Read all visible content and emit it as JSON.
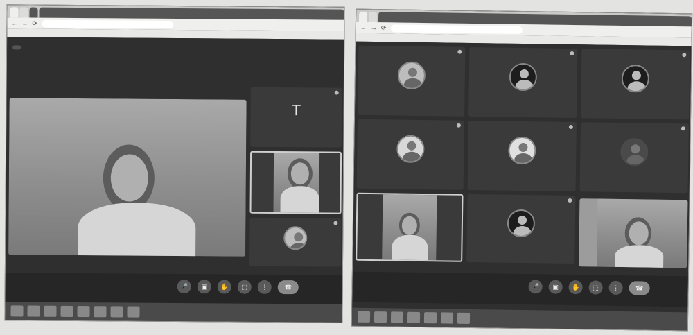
{
  "shot1": {
    "tabs": [
      "",
      "",
      "",
      ""
    ],
    "url": "",
    "bookmarks": [
      "",
      "",
      ""
    ],
    "pill": "",
    "main_tile_name": "",
    "tiles": [
      {
        "letter": "T",
        "name": ""
      },
      {
        "name": ""
      },
      {
        "name": ""
      }
    ],
    "meeting_code": "",
    "controls": [
      "mic-icon",
      "camera-icon",
      "raise-hand-icon",
      "present-icon",
      "more-icon",
      "end-call-icon"
    ],
    "taskbar_icons": [
      "",
      "",
      "",
      "",
      "",
      "",
      "",
      "",
      ""
    ]
  },
  "shot2": {
    "tabs": [
      "",
      "",
      ""
    ],
    "url": "",
    "bookmarks": [
      "",
      "",
      ""
    ],
    "tiles": [
      {
        "name": ""
      },
      {
        "name": ""
      },
      {
        "name": ""
      },
      {
        "name": ""
      },
      {
        "name": ""
      },
      {
        "name": ""
      },
      {
        "name": ""
      },
      {
        "name": ""
      },
      {
        "name": ""
      }
    ],
    "meeting_code": "",
    "controls": [
      "mic-icon",
      "camera-icon",
      "raise-hand-icon",
      "present-icon",
      "more-icon",
      "end-call-icon"
    ],
    "taskbar_icons": [
      "",
      "",
      "",
      "",
      "",
      "",
      "",
      "",
      ""
    ]
  },
  "glyphs": {
    "back": "←",
    "forward": "→",
    "reload": "⟳",
    "mic": "🎤",
    "camera": "▣",
    "hand": "✋",
    "present": "⬚",
    "more": "⋮",
    "end": "☎"
  }
}
